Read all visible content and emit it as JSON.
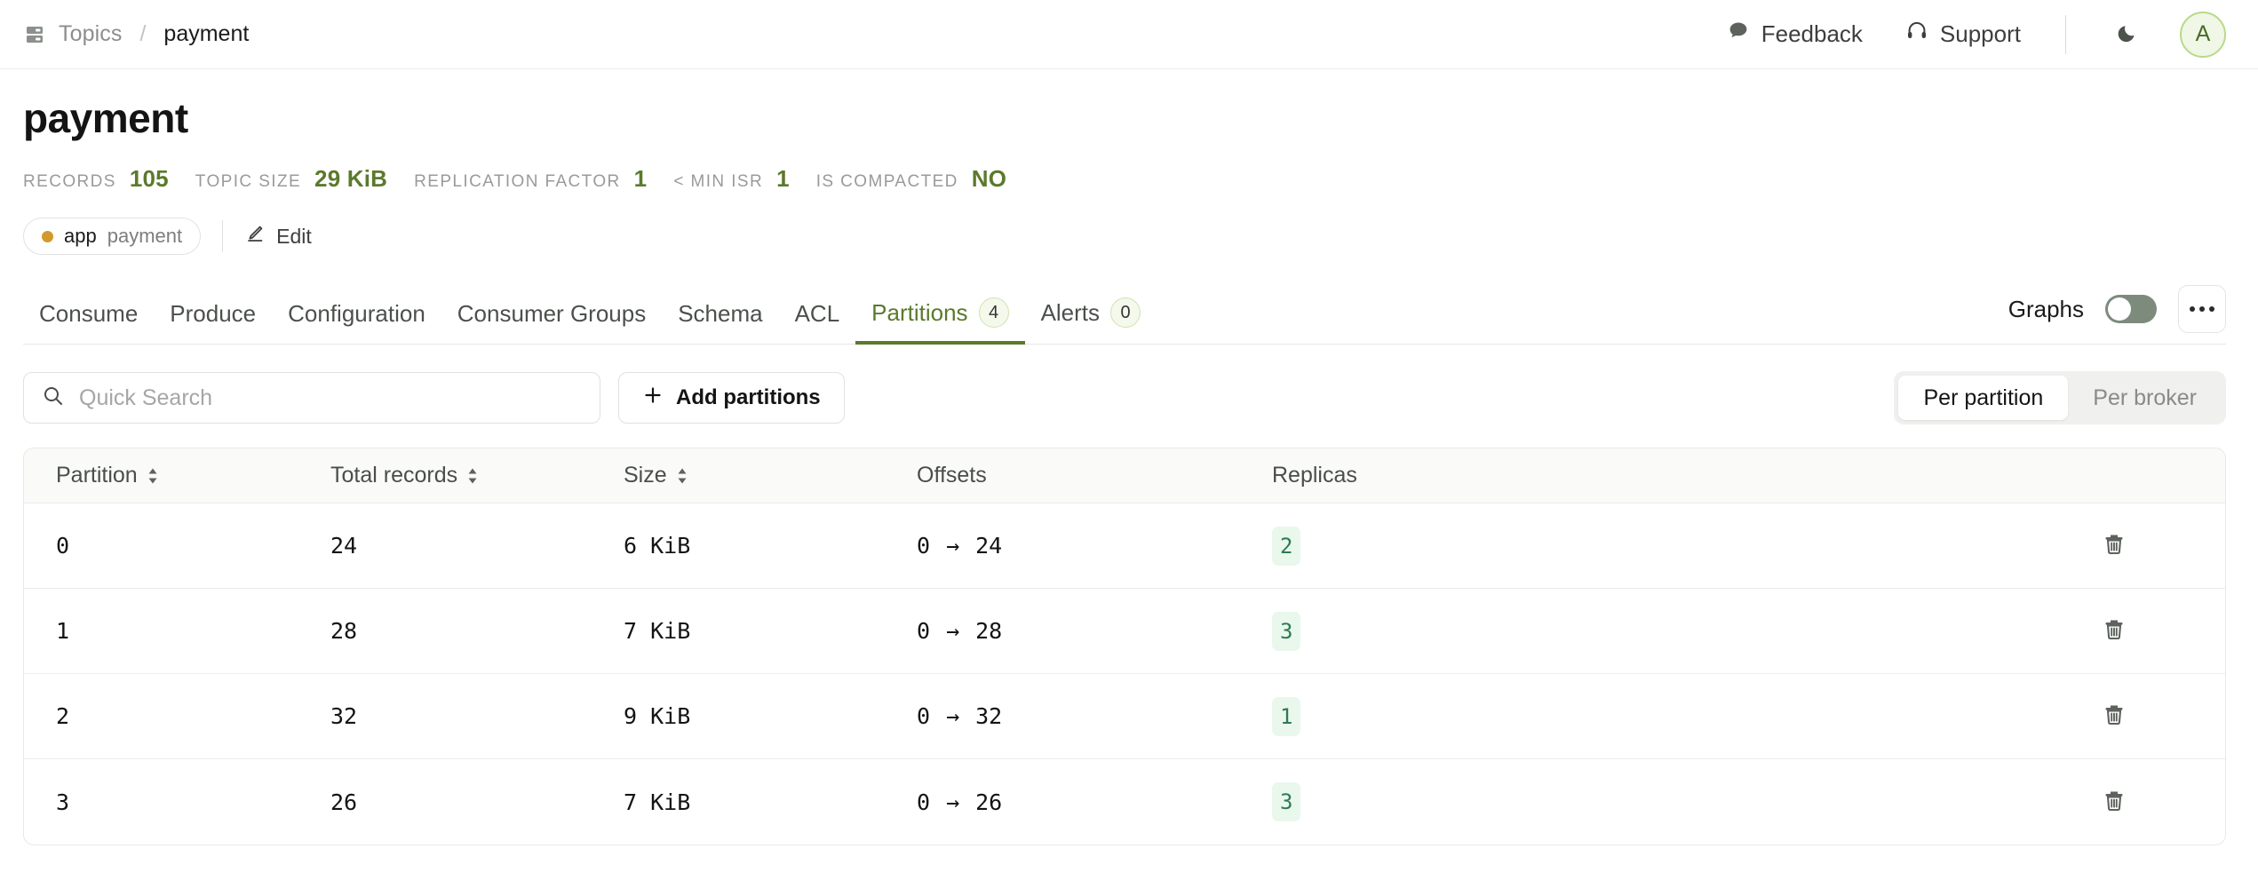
{
  "header": {
    "breadcrumb": {
      "icon": "database-stack-icon",
      "parent": "Topics",
      "separator": "/",
      "current": "payment"
    },
    "feedback_label": "Feedback",
    "feedback_icon": "chat-bubble-icon",
    "support_label": "Support",
    "support_icon": "headset-icon",
    "theme_toggle_icon": "moon-icon",
    "avatar_initial": "A"
  },
  "page": {
    "title": "payment",
    "stats": [
      {
        "label": "RECORDS",
        "value": "105"
      },
      {
        "label": "TOPIC SIZE",
        "value": "29 KiB"
      },
      {
        "label": "REPLICATION FACTOR",
        "value": "1"
      },
      {
        "label": "< MIN ISR",
        "value": "1"
      },
      {
        "label": "IS COMPACTED",
        "value": "NO"
      }
    ],
    "chip": {
      "key": "app",
      "value": "payment",
      "dot_color": "#d19a2a"
    },
    "edit_label": "Edit",
    "edit_icon": "pencil-icon"
  },
  "tabs": {
    "items": [
      {
        "label": "Consume",
        "badge": null,
        "active": false
      },
      {
        "label": "Produce",
        "badge": null,
        "active": false
      },
      {
        "label": "Configuration",
        "badge": null,
        "active": false
      },
      {
        "label": "Consumer Groups",
        "badge": null,
        "active": false
      },
      {
        "label": "Schema",
        "badge": null,
        "active": false
      },
      {
        "label": "ACL",
        "badge": null,
        "active": false
      },
      {
        "label": "Partitions",
        "badge": "4",
        "active": true
      },
      {
        "label": "Alerts",
        "badge": "0",
        "active": false
      }
    ],
    "graphs_label": "Graphs",
    "graphs_enabled": false,
    "more_icon": "kebab-menu-icon"
  },
  "toolbar": {
    "search_placeholder": "Quick Search",
    "search_value": "",
    "search_icon": "search-icon",
    "add_partitions_label": "Add partitions",
    "add_icon": "plus-icon",
    "view_modes": [
      {
        "label": "Per partition",
        "active": true
      },
      {
        "label": "Per broker",
        "active": false
      }
    ]
  },
  "table": {
    "columns": [
      {
        "label": "Partition",
        "sortable": true
      },
      {
        "label": "Total records",
        "sortable": true
      },
      {
        "label": "Size",
        "sortable": true
      },
      {
        "label": "Offsets",
        "sortable": false
      },
      {
        "label": "Replicas",
        "sortable": false
      }
    ],
    "arrow_glyph": "→",
    "delete_icon": "trash-icon",
    "rows": [
      {
        "partition": "0",
        "total_records": "24",
        "size": "6 KiB",
        "offset_start": "0",
        "offset_end": "24",
        "replicas": "2"
      },
      {
        "partition": "1",
        "total_records": "28",
        "size": "7 KiB",
        "offset_start": "0",
        "offset_end": "28",
        "replicas": "3"
      },
      {
        "partition": "2",
        "total_records": "32",
        "size": "9 KiB",
        "offset_start": "0",
        "offset_end": "32",
        "replicas": "1"
      },
      {
        "partition": "3",
        "total_records": "26",
        "size": "7 KiB",
        "offset_start": "0",
        "offset_end": "26",
        "replicas": "3"
      }
    ]
  },
  "colors": {
    "accent_green": "#5b7a2c",
    "badge_green_bg": "#e9f7ed",
    "badge_green_text": "#2f7a52",
    "chip_dot": "#d19a2a"
  }
}
